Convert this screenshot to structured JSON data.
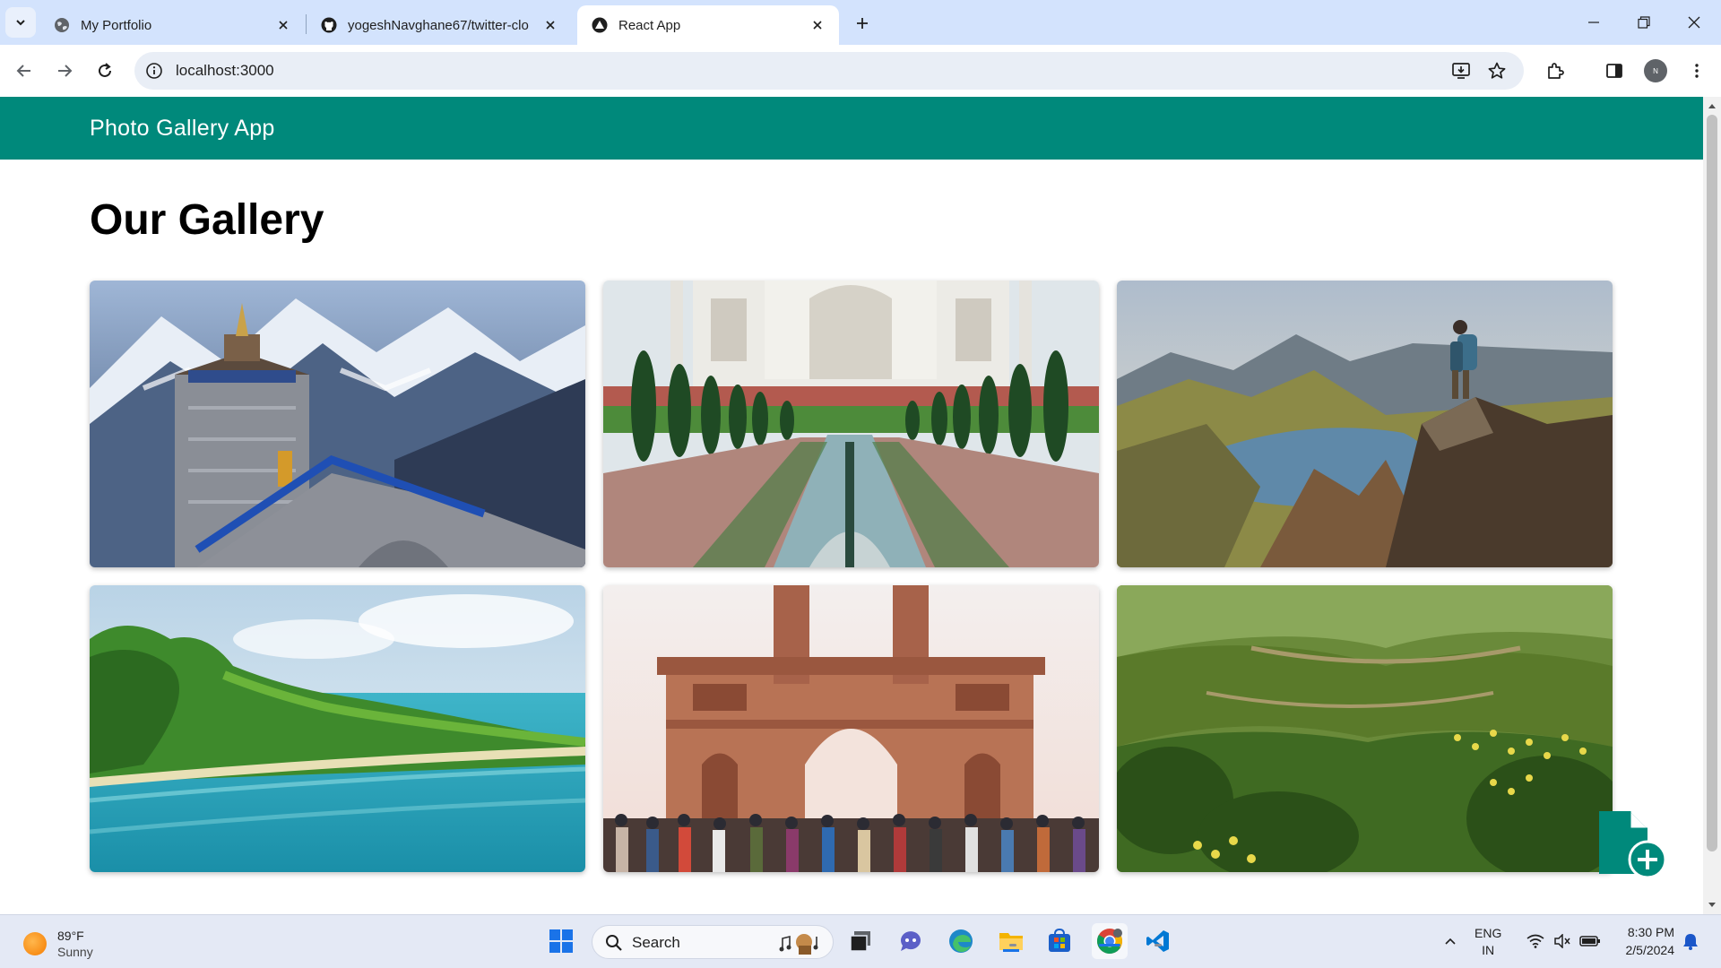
{
  "browser": {
    "tabs": [
      {
        "label": "My Portfolio",
        "icon": "globe-icon",
        "active": false
      },
      {
        "label": "yogeshNavghane67/twitter-clo",
        "icon": "github-icon",
        "active": false
      },
      {
        "label": "React App",
        "icon": "react-app-icon",
        "active": true
      }
    ],
    "url": "localhost:3000",
    "profile_initials": "N"
  },
  "app": {
    "brand": "Photo Gallery App",
    "heading": "Our Gallery",
    "accent_color": "#00897b",
    "photos": [
      {
        "name": "kedarnath-temple",
        "icon": "temple-photo"
      },
      {
        "name": "taj-mahal",
        "icon": "taj-mahal-photo"
      },
      {
        "name": "hiker-on-cliff",
        "icon": "mountain-hiker-photo"
      },
      {
        "name": "tropical-coast",
        "icon": "coast-photo"
      },
      {
        "name": "gateway-of-india",
        "icon": "gateway-photo"
      },
      {
        "name": "green-hills",
        "icon": "hills-photo"
      }
    ],
    "fab_icon": "add-file-icon"
  },
  "taskbar": {
    "weather": {
      "temp": "89°F",
      "condition": "Sunny"
    },
    "search_label": "Search",
    "lang": {
      "line1": "ENG",
      "line2": "IN"
    },
    "clock": {
      "time": "8:30 PM",
      "date": "2/5/2024"
    }
  }
}
